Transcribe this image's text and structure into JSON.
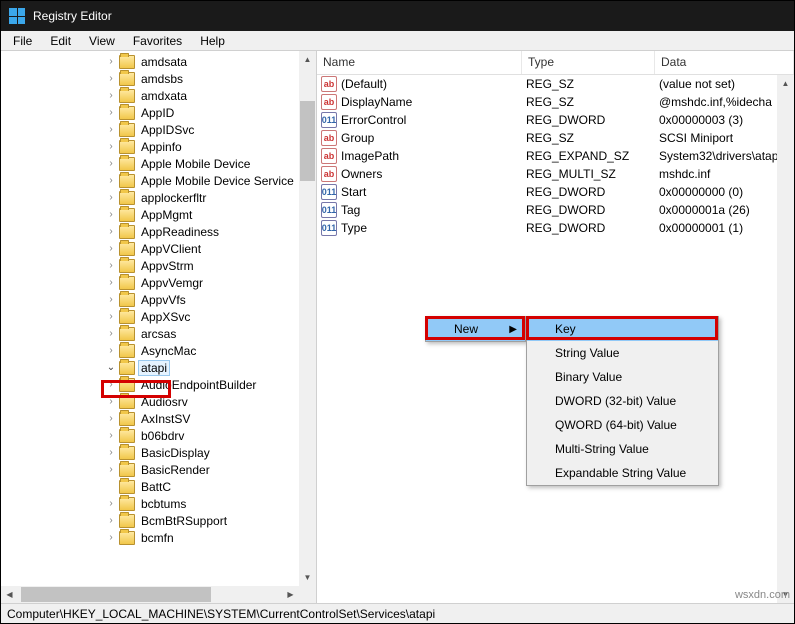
{
  "window": {
    "title": "Registry Editor"
  },
  "menubar": [
    "File",
    "Edit",
    "View",
    "Favorites",
    "Help"
  ],
  "tree": [
    {
      "label": "amdsata",
      "exp": "closed"
    },
    {
      "label": "amdsbs",
      "exp": "closed"
    },
    {
      "label": "amdxata",
      "exp": "closed"
    },
    {
      "label": "AppID",
      "exp": "closed"
    },
    {
      "label": "AppIDSvc",
      "exp": "closed"
    },
    {
      "label": "Appinfo",
      "exp": "closed"
    },
    {
      "label": "Apple Mobile Device",
      "exp": "closed"
    },
    {
      "label": "Apple Mobile Device Service",
      "exp": "closed"
    },
    {
      "label": "applockerfltr",
      "exp": "closed"
    },
    {
      "label": "AppMgmt",
      "exp": "closed"
    },
    {
      "label": "AppReadiness",
      "exp": "closed"
    },
    {
      "label": "AppVClient",
      "exp": "closed"
    },
    {
      "label": "AppvStrm",
      "exp": "closed"
    },
    {
      "label": "AppvVemgr",
      "exp": "closed"
    },
    {
      "label": "AppvVfs",
      "exp": "closed"
    },
    {
      "label": "AppXSvc",
      "exp": "closed"
    },
    {
      "label": "arcsas",
      "exp": "closed"
    },
    {
      "label": "AsyncMac",
      "exp": "closed"
    },
    {
      "label": "atapi",
      "exp": "open",
      "selected": true,
      "highlight": true
    },
    {
      "label": "AudioEndpointBuilder",
      "exp": "closed"
    },
    {
      "label": "Audiosrv",
      "exp": "closed"
    },
    {
      "label": "AxInstSV",
      "exp": "closed"
    },
    {
      "label": "b06bdrv",
      "exp": "closed"
    },
    {
      "label": "BasicDisplay",
      "exp": "closed"
    },
    {
      "label": "BasicRender",
      "exp": "closed"
    },
    {
      "label": "BattC",
      "exp": "none"
    },
    {
      "label": "bcbtums",
      "exp": "closed"
    },
    {
      "label": "BcmBtRSupport",
      "exp": "closed"
    },
    {
      "label": "bcmfn",
      "exp": "closed"
    }
  ],
  "columns": {
    "name": "Name",
    "type": "Type",
    "data": "Data"
  },
  "values": [
    {
      "icon": "str",
      "name": "(Default)",
      "type": "REG_SZ",
      "data": "(value not set)"
    },
    {
      "icon": "str",
      "name": "DisplayName",
      "type": "REG_SZ",
      "data": "@mshdc.inf,%idecha"
    },
    {
      "icon": "bin",
      "name": "ErrorControl",
      "type": "REG_DWORD",
      "data": "0x00000003 (3)"
    },
    {
      "icon": "str",
      "name": "Group",
      "type": "REG_SZ",
      "data": "SCSI Miniport"
    },
    {
      "icon": "str",
      "name": "ImagePath",
      "type": "REG_EXPAND_SZ",
      "data": "System32\\drivers\\atap"
    },
    {
      "icon": "str",
      "name": "Owners",
      "type": "REG_MULTI_SZ",
      "data": "mshdc.inf"
    },
    {
      "icon": "bin",
      "name": "Start",
      "type": "REG_DWORD",
      "data": "0x00000000 (0)"
    },
    {
      "icon": "bin",
      "name": "Tag",
      "type": "REG_DWORD",
      "data": "0x0000001a (26)"
    },
    {
      "icon": "bin",
      "name": "Type",
      "type": "REG_DWORD",
      "data": "0x00000001 (1)"
    }
  ],
  "ctx1": {
    "new": "New"
  },
  "ctx2": [
    "Key",
    "String Value",
    "Binary Value",
    "DWORD (32-bit) Value",
    "QWORD (64-bit) Value",
    "Multi-String Value",
    "Expandable String Value"
  ],
  "status": "Computer\\HKEY_LOCAL_MACHINE\\SYSTEM\\CurrentControlSet\\Services\\atapi",
  "watermark": "wsxdn.com"
}
